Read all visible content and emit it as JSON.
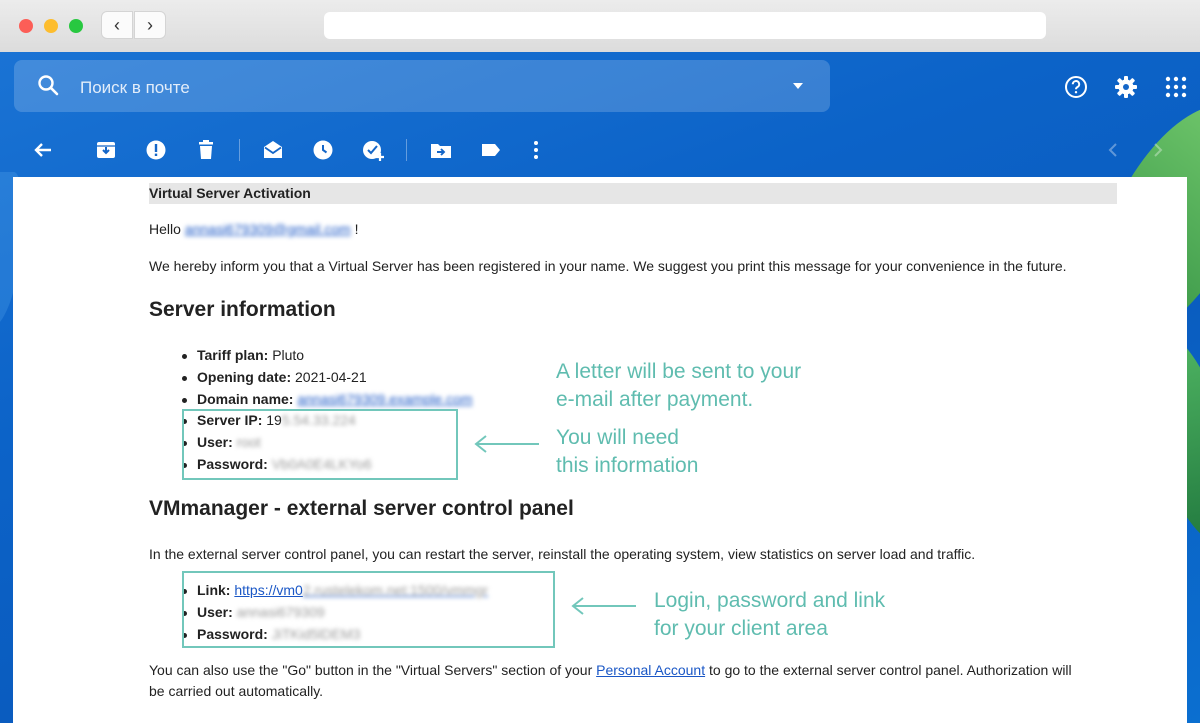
{
  "browser": {
    "back_label": "‹",
    "forward_label": "›"
  },
  "search": {
    "placeholder": "Поиск в почте"
  },
  "header_icons": [
    "help-icon",
    "settings-icon",
    "apps-icon"
  ],
  "toolbar_icons": [
    "back-arrow-icon",
    "archive-icon",
    "report-spam-icon",
    "delete-icon",
    "mark-unread-icon",
    "snooze-icon",
    "add-task-icon",
    "move-to-icon",
    "label-icon",
    "more-icon",
    "prev-icon",
    "next-icon"
  ],
  "email": {
    "subject": "Virtual Server Activation",
    "greeting_prefix": "Hello ",
    "greeting_email": "annasi679309@gmail.com",
    "greeting_suffix": " !",
    "intro": "We hereby inform you that a Virtual Server has been registered in your name. We suggest you print this message for your convenience in the future.",
    "server_info_heading": "Server information",
    "server_info": {
      "tariff_label": "Tariff plan:",
      "tariff_value": "Pluto",
      "opening_label": "Opening date:",
      "opening_value": "2021-04-21",
      "domain_label": "Domain name:",
      "domain_value": "annasi679309.example.com",
      "ip_label": "Server IP:",
      "ip_value_visible": "19",
      "ip_value_blurred": "5.54.33.224",
      "user_label": "User:",
      "user_value": "root",
      "password_label": "Password:",
      "password_value": "Vb0A0E4LKYo6"
    },
    "panel_heading": "VMmanager - external server control panel",
    "panel_intro": "In the external server control panel, you can restart the server, reinstall the operating system, view statistics on server load and traffic.",
    "panel_info": {
      "link_label": "Link:",
      "link_visible": "https://vm0",
      "link_blurred": "2.rustelekom.net:1500/vmmgr",
      "user_label": "User:",
      "user_value": "annasi679309",
      "password_label": "Password:",
      "password_value": "JiTKid5lDEM3"
    },
    "footer_part1": "You can also use the \"Go\" button in the \"Virtual Servers\" section of your ",
    "footer_link": "Personal Account",
    "footer_part2": " to go to the external server control panel. Authorization will",
    "footer_line2": "be carried out automatically."
  },
  "annotations": {
    "letter_line1": "A letter will be sent to your",
    "letter_line2": "e-mail after payment.",
    "need_line1": "You will need",
    "need_line2": "this information",
    "login_line1": "Login, password and link",
    "login_line2": "for your client area"
  },
  "colors": {
    "annotation": "#5fbcaf",
    "gmail_blue": "#0c63c8",
    "link": "#1a57c6"
  }
}
